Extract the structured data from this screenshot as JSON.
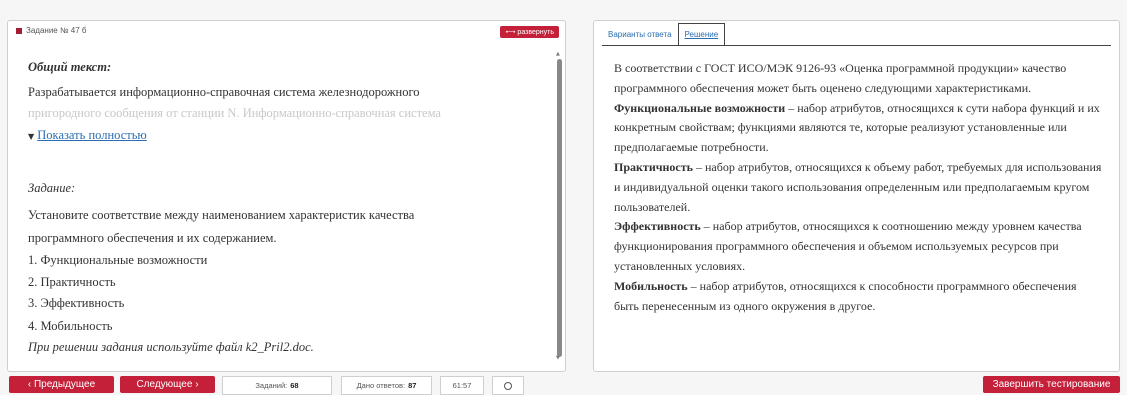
{
  "question": {
    "header": "Задание № 47 б",
    "expand_label": "⟷ развернуть",
    "common_text_heading": "Общий текст:",
    "common_text_line1": "Разрабатывается информационно-справочная система железнодорожного",
    "common_text_line2": "пригородного сообщения от станции N. Информационно-справочная система",
    "show_more_label": "Показать полностью",
    "task_heading": "Задание:",
    "task_line1": "Установите соответствие между наименованием характеристик качества",
    "task_line2": "программного обеспечения и их содержанием.",
    "items": [
      "1. Функциональные возможности",
      "2. Практичность",
      "3. Эффективность",
      "4. Мобильность"
    ],
    "note": "При решении задания используйте файл k2_Pril2.doc."
  },
  "tabs": {
    "answers": "Варианты ответа",
    "solution": "Решение"
  },
  "solution": {
    "intro": "В соответствии с ГОСТ ИСО/МЭК 9126-93 «Оценка программной продукции» качество программного обеспечения может быть оценено следующими характеристиками.",
    "items": [
      {
        "term": "Функциональные возможности",
        "text": " – набор атрибутов, относящихся к сути набора функций и их конкретным свойствам; функциями являются те, которые реализуют установленные или предполагаемые потребности."
      },
      {
        "term": "Практичность",
        "text": " – набор атрибутов, относящихся к объему работ, требуемых для использования и индивидуальной оценки такого использования определенным или предполагаемым кругом пользователей."
      },
      {
        "term": "Эффективность",
        "text": " – набор атрибутов, относящихся к соотношению между уровнем качества функционирования программного обеспечения и объемом используемых ресурсов при установленных условиях."
      },
      {
        "term": "Мобильность",
        "text": " – набор атрибутов, относящихся к способности программного обеспечения быть перенесенным из одного окружения в другое."
      }
    ]
  },
  "footer": {
    "prev_label": "‹ Предыдущее",
    "next_label": "Следующее ›",
    "tasks_label": "Заданий:",
    "tasks_value": "68",
    "answers_label": "Дано ответов:",
    "answers_value": "87",
    "timer": "61:57",
    "finish_label": "Завершить тестирование"
  },
  "colors": {
    "accent": "#c4203a",
    "link": "#2a6db0"
  },
  "icons": {
    "clock": "clock-icon",
    "chevron": "chevron-down-icon"
  }
}
